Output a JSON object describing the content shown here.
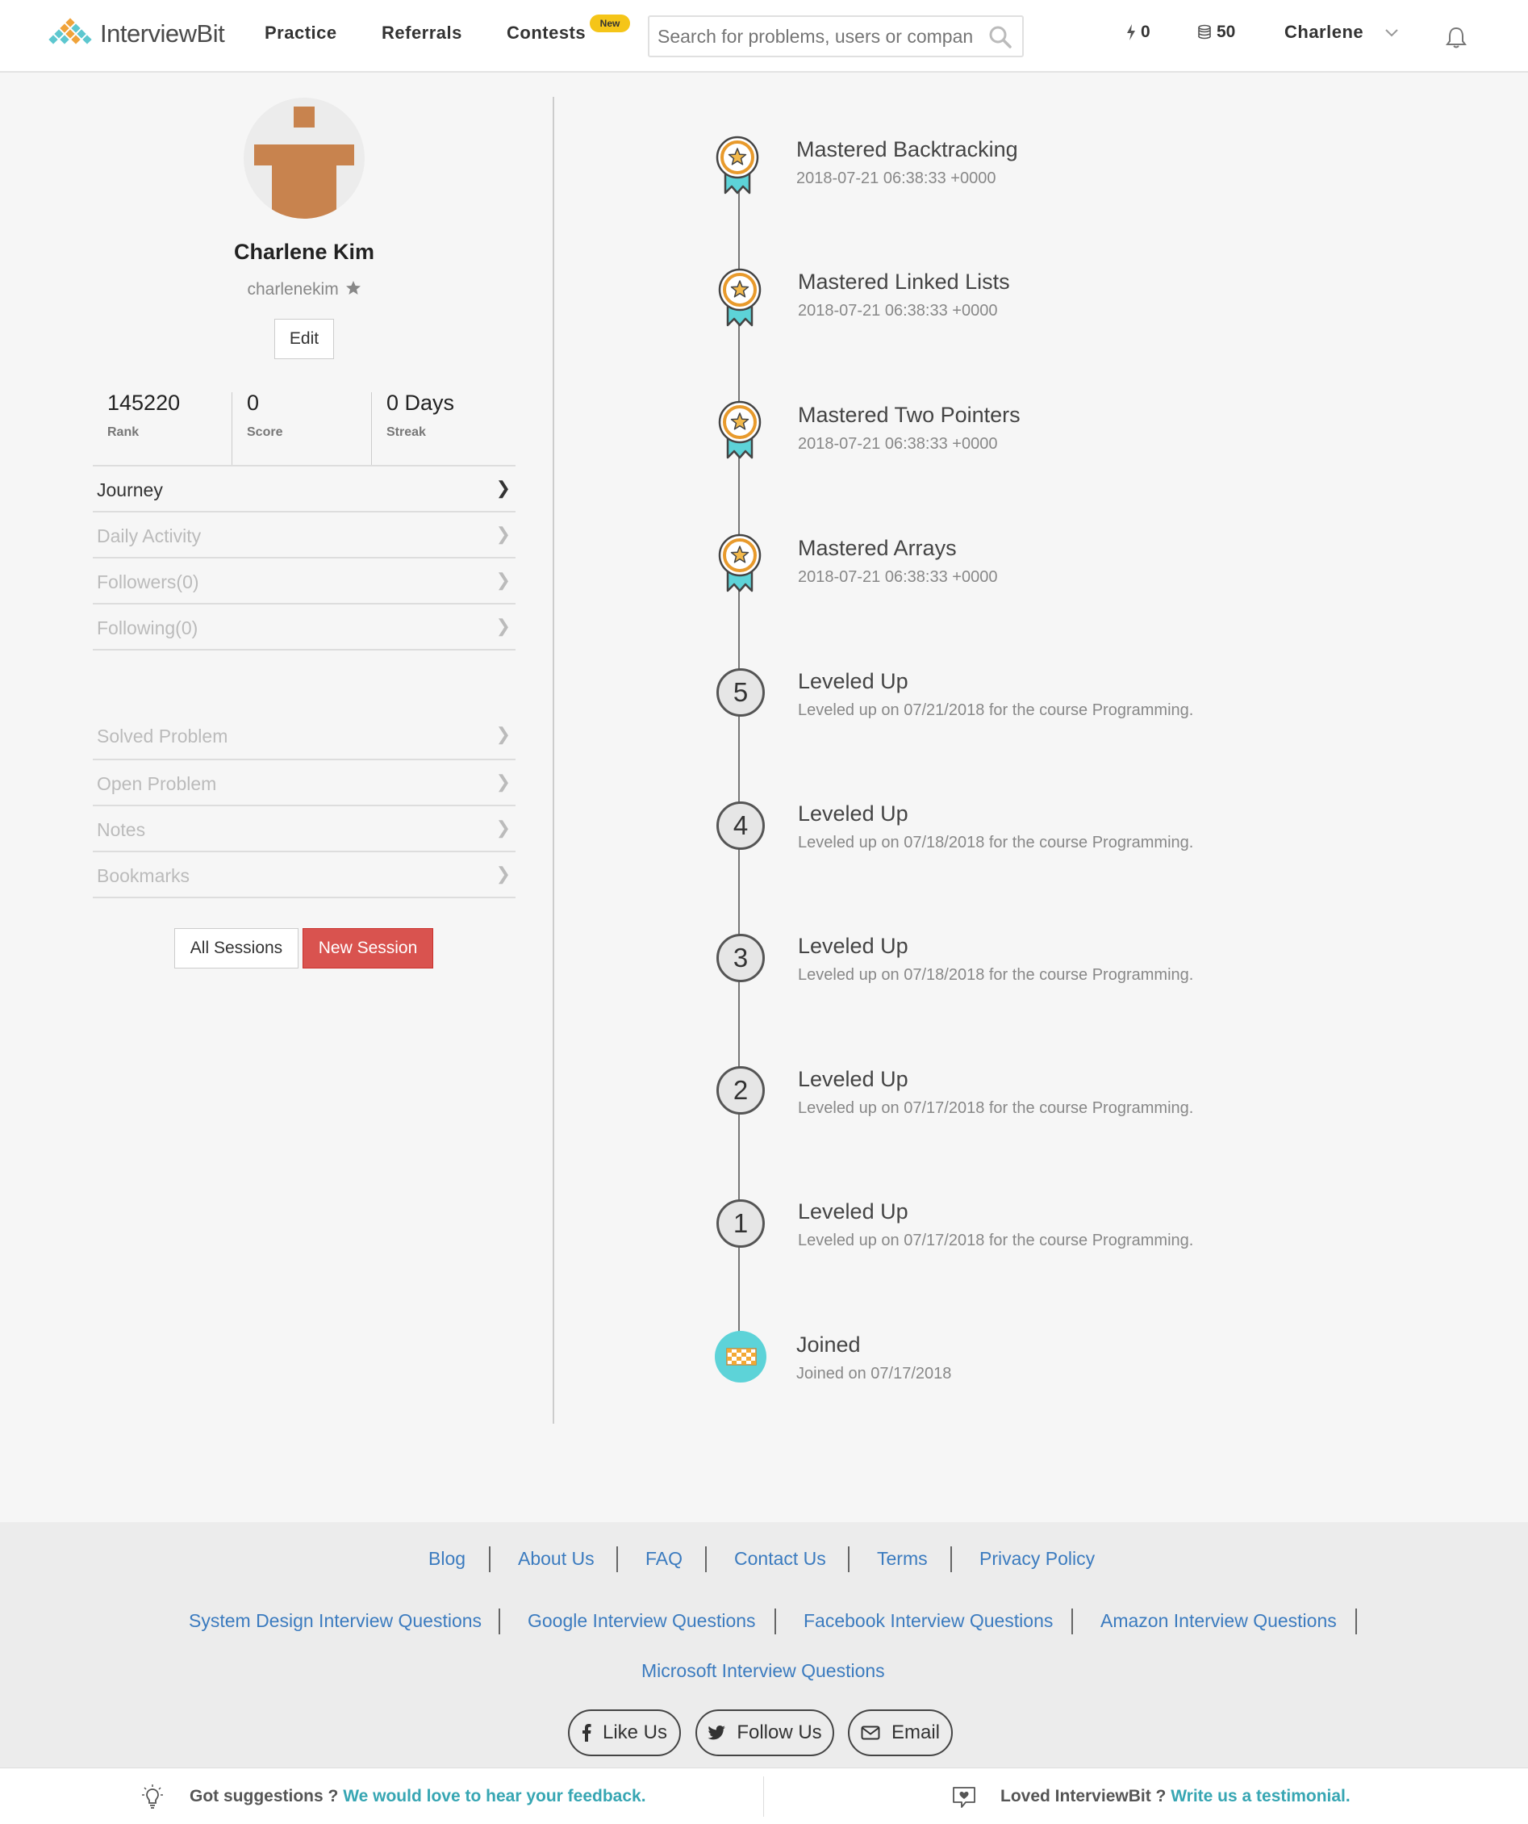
{
  "header": {
    "logo_text": "InterviewBit",
    "nav": [
      {
        "label": "Practice"
      },
      {
        "label": "Referrals"
      },
      {
        "label": "Contests"
      }
    ],
    "new_badge": "New",
    "search_placeholder": "Search for problems, users or companies",
    "streak_count": "0",
    "coins": "50",
    "user": "Charlene"
  },
  "profile": {
    "name": "Charlene Kim",
    "username": "charlenekim",
    "edit_label": "Edit",
    "stats": [
      {
        "value": "145220",
        "label": "Rank"
      },
      {
        "value": "0",
        "label": "Score"
      },
      {
        "value": "0 Days",
        "label": "Streak"
      }
    ]
  },
  "menu_top": [
    {
      "label": "Journey",
      "active": true
    },
    {
      "label": "Daily Activity"
    },
    {
      "label": "Followers(0)"
    },
    {
      "label": "Following(0)"
    }
  ],
  "menu_bottom": [
    {
      "label": "Solved Problem"
    },
    {
      "label": "Open Problem"
    },
    {
      "label": "Notes"
    },
    {
      "label": "Bookmarks"
    }
  ],
  "sessions": {
    "all_label": "All Sessions",
    "new_label": "New Session"
  },
  "timeline": [
    {
      "kind": "badge",
      "title": "Mastered Backtracking",
      "sub": "2018-07-21 06:38:33 +0000"
    },
    {
      "kind": "badge",
      "title": "Mastered Linked Lists",
      "sub": "2018-07-21 06:38:33 +0000"
    },
    {
      "kind": "badge",
      "title": "Mastered Two Pointers",
      "sub": "2018-07-21 06:38:33 +0000"
    },
    {
      "kind": "badge",
      "title": "Mastered Arrays",
      "sub": "2018-07-21 06:38:33 +0000"
    },
    {
      "kind": "level",
      "level": "5",
      "title": "Leveled Up",
      "sub": "Leveled up on 07/21/2018 for the course Programming."
    },
    {
      "kind": "level",
      "level": "4",
      "title": "Leveled Up",
      "sub": "Leveled up on 07/18/2018 for the course Programming."
    },
    {
      "kind": "level",
      "level": "3",
      "title": "Leveled Up",
      "sub": "Leveled up on 07/18/2018 for the course Programming."
    },
    {
      "kind": "level",
      "level": "2",
      "title": "Leveled Up",
      "sub": "Leveled up on 07/17/2018 for the course Programming."
    },
    {
      "kind": "level",
      "level": "1",
      "title": "Leveled Up",
      "sub": "Leveled up on 07/17/2018 for the course Programming."
    },
    {
      "kind": "join",
      "title": "Joined",
      "sub": "Joined on 07/17/2018"
    }
  ],
  "footer": {
    "row1": [
      "Blog",
      "About Us",
      "FAQ",
      "Contact Us",
      "Terms",
      "Privacy Policy"
    ],
    "row2": [
      "System Design Interview Questions",
      "Google Interview Questions",
      "Facebook Interview Questions",
      "Amazon Interview Questions"
    ],
    "row3": [
      "Microsoft Interview Questions"
    ],
    "social": [
      {
        "label": "Like Us",
        "icon": "facebook-icon"
      },
      {
        "label": "Follow Us",
        "icon": "twitter-icon"
      },
      {
        "label": "Email",
        "icon": "envelope-icon"
      }
    ],
    "feedback_left_q": "Got suggestions ?",
    "feedback_left_link": "We would love to hear your feedback.",
    "feedback_right_q": "Loved InterviewBit ?",
    "feedback_right_link": "Write us a testimonial."
  },
  "colors": {
    "accent": "#37a6b3",
    "danger": "#d9534f",
    "link": "#3b7bbf",
    "badge": "#f5c518"
  }
}
